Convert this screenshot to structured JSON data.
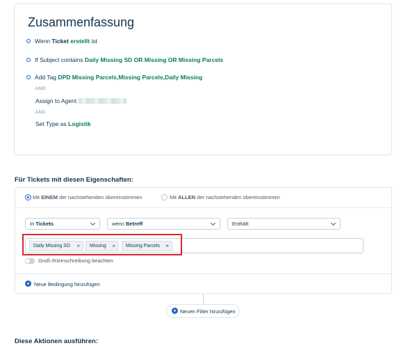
{
  "summary": {
    "title": "Zusammenfassung",
    "rule1": {
      "prefix": "Wenn ",
      "keyword": "Ticket",
      "value": "erstellt",
      "suffix": " ist"
    },
    "rule2": {
      "prefix": "If Subject contains ",
      "value": "Daily Missing SD OR Missing OR Missing Parcels"
    },
    "rule3": {
      "prefix": "Add Tag ",
      "value": "DPD Missing Parcels,Missing Parcels,Daily Missing",
      "and1": "AND",
      "assign_label": "Assign to Agent",
      "and2": "AND",
      "set_type_prefix": "Set Type as ",
      "set_type_value": "Logistik"
    }
  },
  "filters": {
    "section_title": "Für Tickets mit diesen Eigenschaften:",
    "match_any": {
      "prefix": "Mit ",
      "strong": "EINEM",
      "suffix": " der nachstehenden übereinstimmen"
    },
    "match_all": {
      "prefix": "Mit ",
      "strong": "ALLEN",
      "suffix": " der nachstehenden übereinstimmen"
    },
    "condition": {
      "scope_prefix": "In ",
      "scope_value": "Tickets",
      "field_prefix": "wenn ",
      "field_value": "Betreff",
      "operator": "Enthält",
      "tags": [
        {
          "label": "Daily Missing SD",
          "remove": "×"
        },
        {
          "label": "Missing",
          "remove": "×"
        },
        {
          "label": "Missing Parcels",
          "remove": "×"
        }
      ],
      "case_sensitive_label": "Groß-/Kleinschreibung beachten"
    },
    "add_condition_label": "Neue Bedingung hinzufügen",
    "add_filter_label": "Neuen Filter hinzufügen",
    "plus_symbol": "+"
  },
  "actions": {
    "section_title": "Diese Aktionen ausführen:"
  },
  "colors": {
    "accent": "#1f5fbf",
    "value_green": "#0b7a5f",
    "highlight_red": "#d9262f",
    "text_dark": "#12344d"
  }
}
